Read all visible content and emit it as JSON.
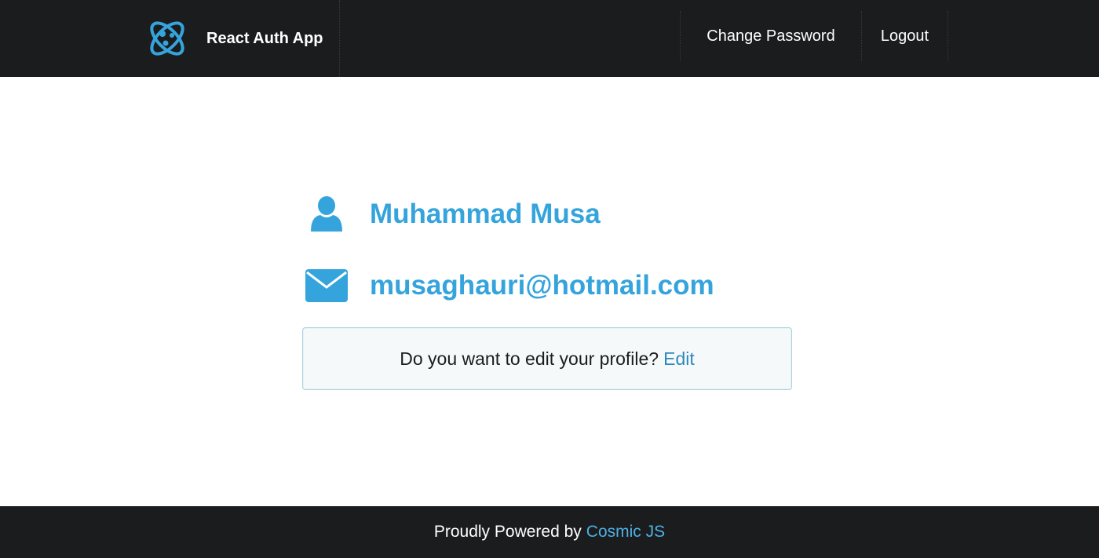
{
  "header": {
    "brand_name": "React Auth App",
    "brand_icon": "atom-logo-icon",
    "nav": {
      "change_password": "Change Password",
      "logout": "Logout"
    }
  },
  "profile": {
    "name": "Muhammad Musa",
    "name_icon": "user-icon",
    "email": "musaghauri@hotmail.com",
    "email_icon": "envelope-icon"
  },
  "edit_prompt": {
    "text": "Do you want to edit your profile?",
    "link": "Edit"
  },
  "footer": {
    "text": "Proudly Powered by",
    "link": "Cosmic JS"
  },
  "colors": {
    "header_bg": "#1b1c1d",
    "accent": "#35a4dc",
    "link": "#2e87bd",
    "box_bg": "#f6f9fa",
    "box_border": "#a9d5de"
  }
}
